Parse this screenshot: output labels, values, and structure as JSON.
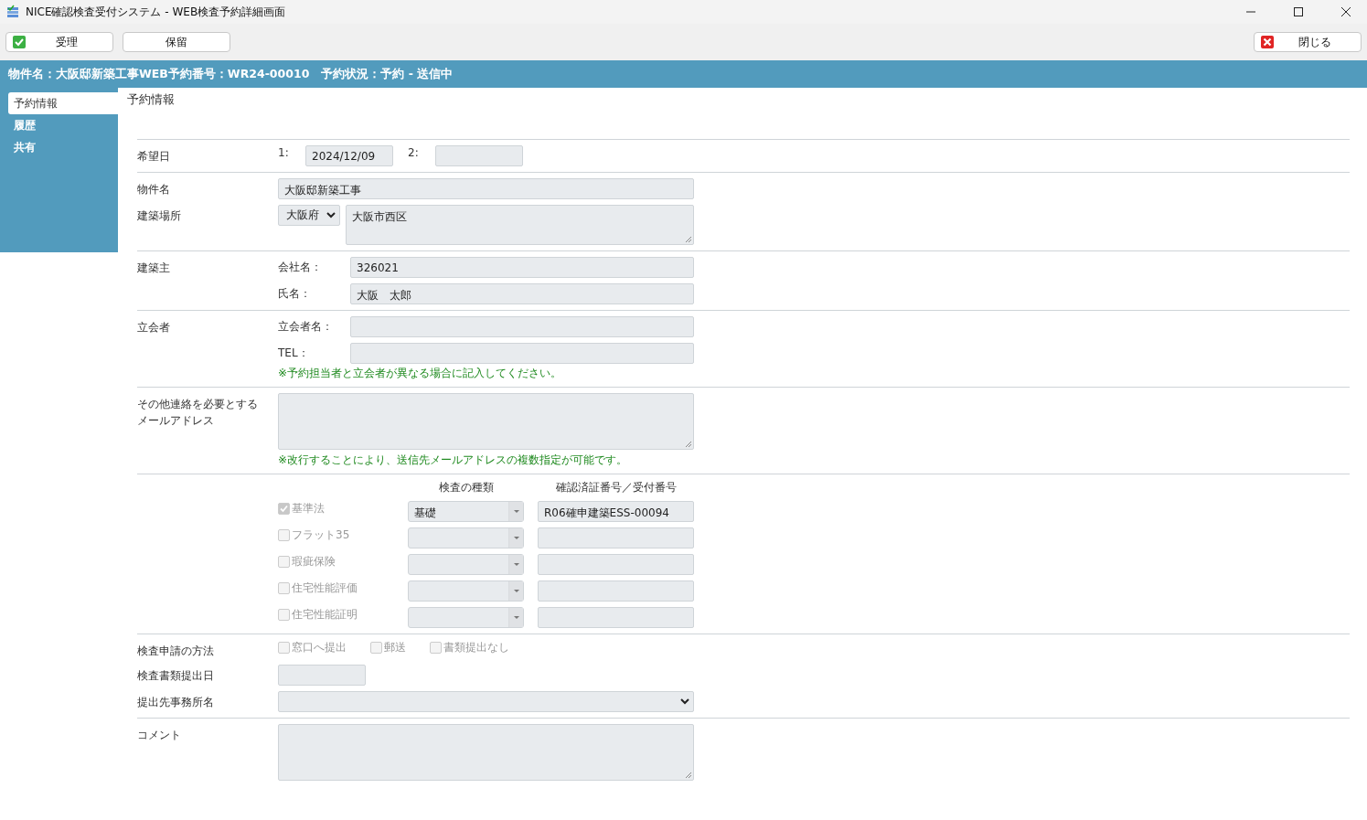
{
  "window": {
    "title": "NICE確認検査受付システム - WEB検査予約詳細画面"
  },
  "toolbar": {
    "buttons": [
      {
        "label": "受理",
        "kind": "accept"
      },
      {
        "label": "保留",
        "kind": "plain"
      },
      {
        "label": "閉じる",
        "kind": "close"
      }
    ]
  },
  "header": {
    "text": "物件名：大阪邸新築工事WEB予約番号：WR24-00010　予約状況：予約 - 送信中"
  },
  "sidebar": {
    "items": [
      {
        "label": "予約情報",
        "selected": true
      },
      {
        "label": "履歴",
        "selected": false
      },
      {
        "label": "共有",
        "selected": false
      }
    ]
  },
  "section_title": "予約情報",
  "desired_date": {
    "label": "希望日",
    "dates": [
      {
        "index": "1:",
        "value": "2024/12/09"
      },
      {
        "index": "2:"
      }
    ]
  },
  "property": {
    "label": "物件名",
    "value": "大阪邸新築工事"
  },
  "site": {
    "label": "建築場所",
    "prefecture": "大阪府",
    "address": "大阪市西区"
  },
  "owner": {
    "label": "建築主",
    "company_label": "会社名：",
    "company": "326021",
    "name_label": "氏名：",
    "name": "大阪　太郎"
  },
  "witness": {
    "label": "立会者",
    "name_label": "立会者名：",
    "tel_label": "TEL：",
    "note": "※予約担当者と立会者が異なる場合に記入してください。"
  },
  "emails": {
    "label": "その他連絡を必要とするメールアドレス",
    "note": "※改行することにより、送信先メールアドレスの複数指定が可能です。"
  },
  "inspections": {
    "columns": [
      "検査の種類",
      "確認済証番号／受付番号"
    ],
    "rows": [
      {
        "label": "基準法",
        "checked": true,
        "type": "基礎",
        "number": "R06確申建築ESS-00094"
      },
      {
        "label": "フラット35",
        "checked": false
      },
      {
        "label": "瑕疵保険",
        "checked": false
      },
      {
        "label": "住宅性能評価",
        "checked": false
      },
      {
        "label": "住宅性能証明",
        "checked": false
      }
    ]
  },
  "method": {
    "label": "検査申請の方法",
    "options": [
      {
        "label": "窓口へ提出",
        "checked": false
      },
      {
        "label": "郵送",
        "checked": false
      },
      {
        "label": "書類提出なし",
        "checked": false
      }
    ]
  },
  "submit_date": {
    "label": "検査書類提出日"
  },
  "office": {
    "label": "提出先事務所名"
  },
  "comment": {
    "label": "コメント"
  }
}
